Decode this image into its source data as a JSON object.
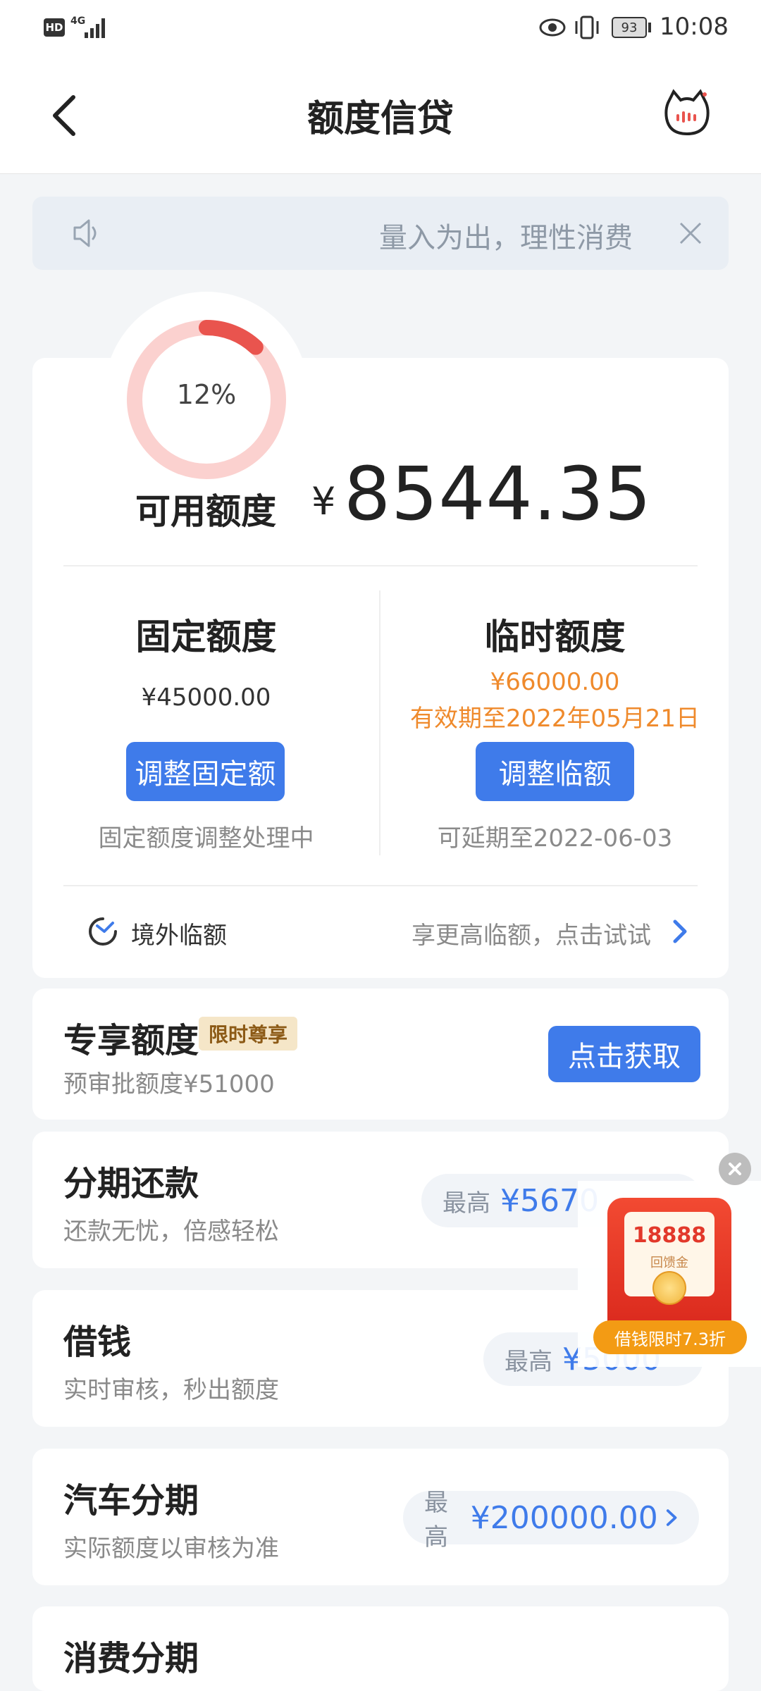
{
  "status": {
    "net": "4G",
    "battery": "93",
    "time": "10:08"
  },
  "header": {
    "title": "额度信贷"
  },
  "notice": {
    "text": "量入为出，理性消费"
  },
  "credit": {
    "percent_label": "12%",
    "percent": 12,
    "available_label": "可用额度",
    "currency": "¥",
    "available_amount": "8544.35",
    "fixed": {
      "title": "固定额度",
      "amount": "¥45000.00",
      "button": "调整固定额",
      "note": "固定额度调整处理中"
    },
    "temp": {
      "title": "临时额度",
      "amount": "¥66000.00",
      "validity": "有效期至2022年05月21日",
      "button": "调整临额",
      "note": "可延期至2022-06-03"
    },
    "overseas": {
      "label": "境外临额",
      "hint": "享更高临额，点击试试"
    }
  },
  "exclusive": {
    "title": "专享额度",
    "badge": "限时尊享",
    "sub": "预审批额度¥51000",
    "button": "点击获取"
  },
  "rows": [
    {
      "title": "分期还款",
      "sub": "还款无忧，倍感轻松",
      "pre": "最高",
      "val": "¥5670"
    },
    {
      "title": "借钱",
      "sub": "实时审核，秒出额度",
      "pre": "最高",
      "val": "¥5000"
    },
    {
      "title": "汽车分期",
      "sub": "实际额度以审核为准",
      "pre": "最高",
      "val": "¥200000.00"
    },
    {
      "title": "消费分期"
    }
  ],
  "promo": {
    "amount": "18888",
    "caption": "回馈金",
    "banner": "借钱限时7.3折"
  },
  "colors": {
    "accent": "#3f7bea",
    "orange": "#ef8a2c",
    "gauge": "#e9544e",
    "gauge_bg": "#fbd1cf"
  }
}
